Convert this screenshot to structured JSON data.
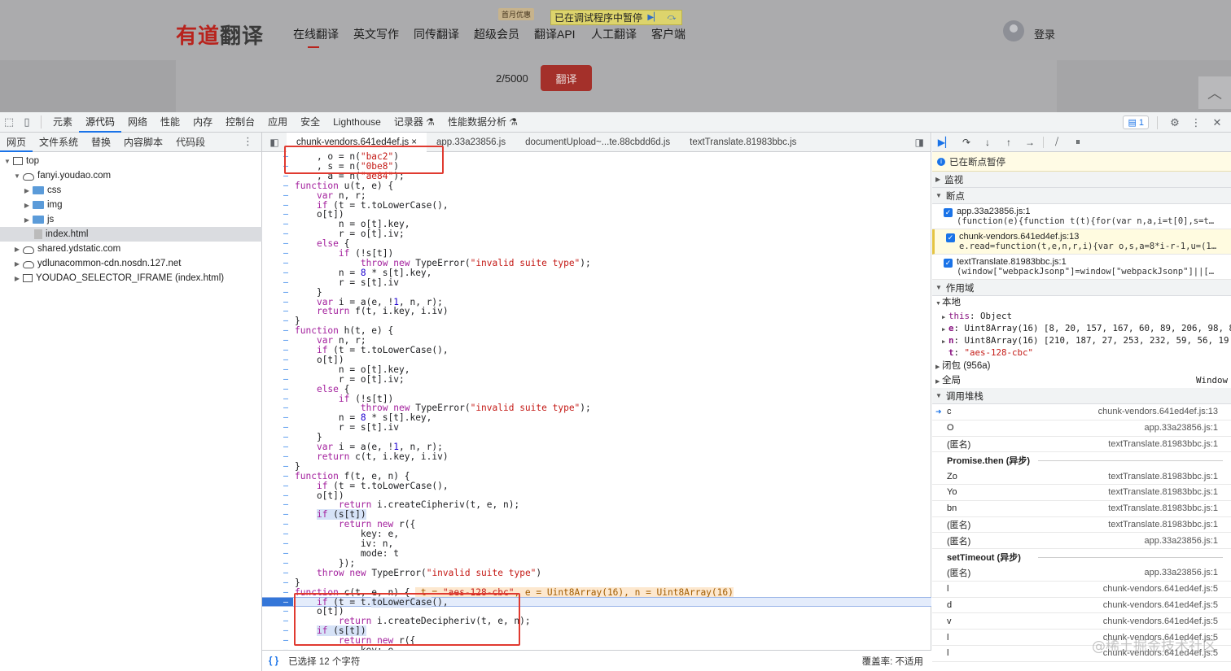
{
  "page": {
    "logo_red": "有道",
    "logo_dark": "翻译",
    "nav": [
      "在线翻译",
      "英文写作",
      "同传翻译",
      "超级会员",
      "翻译API",
      "人工翻译",
      "客户端"
    ],
    "promo_badge": "首月优惠",
    "debugger_paused": "已在调试程序中暂停",
    "login": "登录",
    "char_count": "2/5000",
    "translate_button": "翻译"
  },
  "toolbar": {
    "tabs": [
      "元素",
      "源代码",
      "网络",
      "性能",
      "内存",
      "控制台",
      "应用",
      "安全",
      "Lighthouse",
      "记录器 ⚗",
      "性能数据分析 ⚗"
    ],
    "selected_tab": "源代码",
    "issues_count": "1"
  },
  "navigator": {
    "tabs": [
      "网页",
      "文件系统",
      "替换",
      "内容脚本",
      "代码段"
    ],
    "tree": [
      {
        "label": "top",
        "type": "frame-top",
        "depth": 0,
        "open": true
      },
      {
        "label": "fanyi.youdao.com",
        "type": "cloud",
        "depth": 1,
        "open": true
      },
      {
        "label": "css",
        "type": "folder",
        "depth": 2,
        "open": false
      },
      {
        "label": "img",
        "type": "folder",
        "depth": 2,
        "open": false
      },
      {
        "label": "js",
        "type": "folder",
        "depth": 2,
        "open": false
      },
      {
        "label": "index.html",
        "type": "file",
        "depth": 2,
        "selected": true
      },
      {
        "label": "shared.ydstatic.com",
        "type": "cloud",
        "depth": 1,
        "open": false
      },
      {
        "label": "ydlunacommon-cdn.nosdn.127.net",
        "type": "cloud",
        "depth": 1,
        "open": false
      },
      {
        "label": "YOUDAO_SELECTOR_IFRAME (index.html)",
        "type": "frame",
        "depth": 1,
        "open": false
      }
    ]
  },
  "editor": {
    "tabs": [
      "chunk-vendors.641ed4ef.js ×",
      "app.33a23856.js",
      "documentUpload~...te.88cbdd6d.js",
      "textTranslate.81983bbc.js"
    ],
    "status_left": "已选择 12 个字符",
    "status_right": "覆盖率: 不适用",
    "lines": [
      "    , o = n(\"bac2\")",
      "    , s = n(\"0be8\")",
      "    , a = n(\"ae84\");",
      "function u(t, e) {",
      "    var n, r;",
      "    if (t = t.toLowerCase(),",
      "    o[t])",
      "        n = o[t].key,",
      "        r = o[t].iv;",
      "    else {",
      "        if (!s[t])",
      "            throw new TypeError(\"invalid suite type\");",
      "        n = 8 * s[t].key,",
      "        r = s[t].iv",
      "    }",
      "    var i = a(e, !1, n, r);",
      "    return f(t, i.key, i.iv)",
      "}",
      "function h(t, e) {",
      "    var n, r;",
      "    if (t = t.toLowerCase(),",
      "    o[t])",
      "        n = o[t].key,",
      "        r = o[t].iv;",
      "    else {",
      "        if (!s[t])",
      "            throw new TypeError(\"invalid suite type\");",
      "        n = 8 * s[t].key,",
      "        r = s[t].iv",
      "    }",
      "    var i = a(e, !1, n, r);",
      "    return c(t, i.key, i.iv)",
      "}",
      "function f(t, e, n) {",
      "    if (t = t.toLowerCase(),",
      "    o[t])",
      "        return i.createCipheriv(t, e, n);",
      "    if (s[t])",
      "        return new r({",
      "            key: e,",
      "            iv: n,",
      "            mode: t",
      "        });",
      "    throw new TypeError(\"invalid suite type\")",
      "}",
      "function c(t, e, n) {  t = \"aes-128-cbc\", e = Uint8Array(16), n = Uint8Array(16)",
      "    if (t = t.toLowerCase(),",
      "    o[t])",
      "        return i.createDecipheriv(t, e, n);",
      "    if (s[t])",
      "        return new r({",
      "            key: e"
    ]
  },
  "sidebar": {
    "paused_label": "已在断点暂停",
    "watch": "监视",
    "breakpoints_title": "断点",
    "breakpoints": [
      {
        "file": "app.33a23856.js:1",
        "code": "(function(e){function t(t){for(var n,a,i=t[0],s=t…"
      },
      {
        "file": "chunk-vendors.641ed4ef.js:13",
        "code": "e.read=function(t,e,n,r,i){var o,s,a=8*i-r-1,u=(1…",
        "active": true
      },
      {
        "file": "textTranslate.81983bbc.js:1",
        "code": "(window[\"webpackJsonp\"]=window[\"webpackJsonp\"]||[…"
      }
    ],
    "scope_title": "作用域",
    "local_title": "本地",
    "scope_vars": [
      {
        "k": "this",
        "v": "Object",
        "bold": false,
        "tw": true
      },
      {
        "k": "e",
        "v": "Uint8Array(16) [8, 20, 157, 167, 60, 89, 206, 98, 8",
        "bold": true,
        "tw": true
      },
      {
        "k": "n",
        "v": "Uint8Array(16) [210, 187, 27, 253, 232, 59, 56, 19",
        "bold": true,
        "tw": true
      },
      {
        "k": "t",
        "v": "\"aes-128-cbc\"",
        "bold": true,
        "tw": false,
        "str": true
      }
    ],
    "closure": "闭包 (956a)",
    "global": "全局",
    "global_val": "Window",
    "callstack_title": "调用堆栈",
    "callstack": [
      {
        "name": "c",
        "loc": "chunk-vendors.641ed4ef.js:13",
        "current": true
      },
      {
        "name": "O",
        "loc": "app.33a23856.js:1"
      },
      {
        "name": "(匿名)",
        "loc": "textTranslate.81983bbc.js:1"
      },
      {
        "name": "Promise.then (异步)",
        "async": true
      },
      {
        "name": "Zo",
        "loc": "textTranslate.81983bbc.js:1"
      },
      {
        "name": "Yo",
        "loc": "textTranslate.81983bbc.js:1"
      },
      {
        "name": "bn",
        "loc": "textTranslate.81983bbc.js:1"
      },
      {
        "name": "(匿名)",
        "loc": "textTranslate.81983bbc.js:1"
      },
      {
        "name": "(匿名)",
        "loc": "app.33a23856.js:1"
      },
      {
        "name": "setTimeout (异步)",
        "async": true
      },
      {
        "name": "(匿名)",
        "loc": "app.33a23856.js:1"
      },
      {
        "name": "l",
        "loc": "chunk-vendors.641ed4ef.js:5"
      },
      {
        "name": "d",
        "loc": "chunk-vendors.641ed4ef.js:5"
      },
      {
        "name": "v",
        "loc": "chunk-vendors.641ed4ef.js:5"
      },
      {
        "name": "l",
        "loc": "chunk-vendors.641ed4ef.js:5"
      },
      {
        "name": "l",
        "loc": "chunk-vendors.641ed4ef.js:5"
      }
    ]
  },
  "watermark": "@稀土掘金技术社区"
}
